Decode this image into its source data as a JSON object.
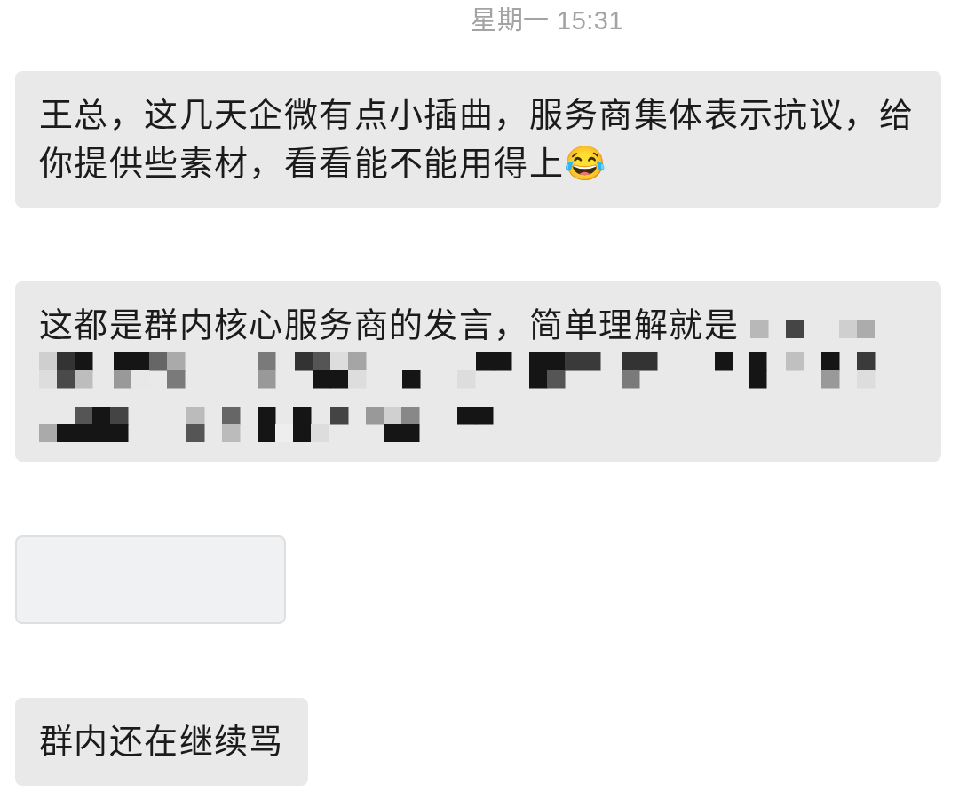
{
  "time_divider": "星期一 15:31",
  "messages": [
    {
      "kind": "text",
      "text": "王总，这几天企微有点小插曲，服务商集体表示抗议，给你提供些素材，看看能不能用得上😂",
      "redacted": false
    },
    {
      "kind": "text",
      "text": "这都是群内核心服务商的发言，简单理解就是",
      "redacted": true
    },
    {
      "kind": "blank"
    },
    {
      "kind": "text",
      "text": "群内还在继续骂",
      "redacted": false
    }
  ]
}
